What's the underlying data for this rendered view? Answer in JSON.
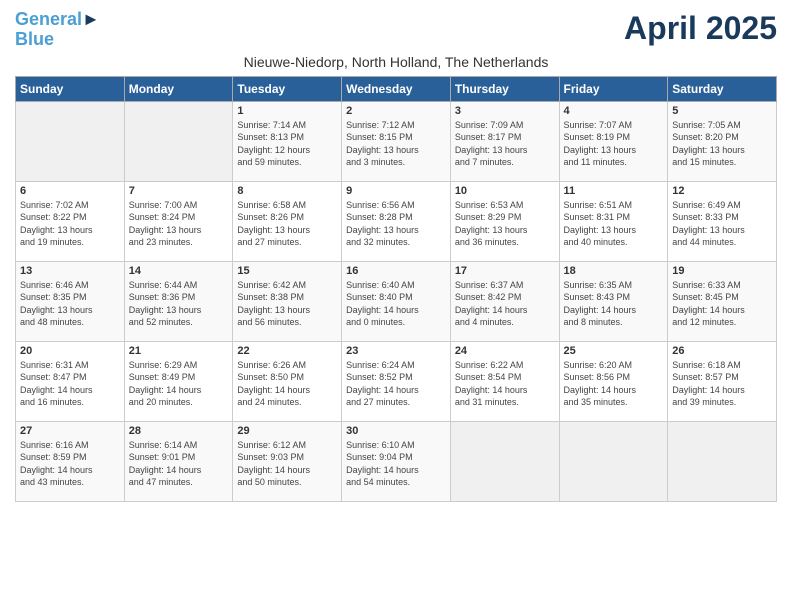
{
  "title": "April 2025",
  "subtitle": "Nieuwe-Niedorp, North Holland, The Netherlands",
  "logo": {
    "line1": "General",
    "line2": "Blue"
  },
  "days_header": [
    "Sunday",
    "Monday",
    "Tuesday",
    "Wednesday",
    "Thursday",
    "Friday",
    "Saturday"
  ],
  "weeks": [
    [
      {
        "day": "",
        "info": ""
      },
      {
        "day": "",
        "info": ""
      },
      {
        "day": "1",
        "info": "Sunrise: 7:14 AM\nSunset: 8:13 PM\nDaylight: 12 hours\nand 59 minutes."
      },
      {
        "day": "2",
        "info": "Sunrise: 7:12 AM\nSunset: 8:15 PM\nDaylight: 13 hours\nand 3 minutes."
      },
      {
        "day": "3",
        "info": "Sunrise: 7:09 AM\nSunset: 8:17 PM\nDaylight: 13 hours\nand 7 minutes."
      },
      {
        "day": "4",
        "info": "Sunrise: 7:07 AM\nSunset: 8:19 PM\nDaylight: 13 hours\nand 11 minutes."
      },
      {
        "day": "5",
        "info": "Sunrise: 7:05 AM\nSunset: 8:20 PM\nDaylight: 13 hours\nand 15 minutes."
      }
    ],
    [
      {
        "day": "6",
        "info": "Sunrise: 7:02 AM\nSunset: 8:22 PM\nDaylight: 13 hours\nand 19 minutes."
      },
      {
        "day": "7",
        "info": "Sunrise: 7:00 AM\nSunset: 8:24 PM\nDaylight: 13 hours\nand 23 minutes."
      },
      {
        "day": "8",
        "info": "Sunrise: 6:58 AM\nSunset: 8:26 PM\nDaylight: 13 hours\nand 27 minutes."
      },
      {
        "day": "9",
        "info": "Sunrise: 6:56 AM\nSunset: 8:28 PM\nDaylight: 13 hours\nand 32 minutes."
      },
      {
        "day": "10",
        "info": "Sunrise: 6:53 AM\nSunset: 8:29 PM\nDaylight: 13 hours\nand 36 minutes."
      },
      {
        "day": "11",
        "info": "Sunrise: 6:51 AM\nSunset: 8:31 PM\nDaylight: 13 hours\nand 40 minutes."
      },
      {
        "day": "12",
        "info": "Sunrise: 6:49 AM\nSunset: 8:33 PM\nDaylight: 13 hours\nand 44 minutes."
      }
    ],
    [
      {
        "day": "13",
        "info": "Sunrise: 6:46 AM\nSunset: 8:35 PM\nDaylight: 13 hours\nand 48 minutes."
      },
      {
        "day": "14",
        "info": "Sunrise: 6:44 AM\nSunset: 8:36 PM\nDaylight: 13 hours\nand 52 minutes."
      },
      {
        "day": "15",
        "info": "Sunrise: 6:42 AM\nSunset: 8:38 PM\nDaylight: 13 hours\nand 56 minutes."
      },
      {
        "day": "16",
        "info": "Sunrise: 6:40 AM\nSunset: 8:40 PM\nDaylight: 14 hours\nand 0 minutes."
      },
      {
        "day": "17",
        "info": "Sunrise: 6:37 AM\nSunset: 8:42 PM\nDaylight: 14 hours\nand 4 minutes."
      },
      {
        "day": "18",
        "info": "Sunrise: 6:35 AM\nSunset: 8:43 PM\nDaylight: 14 hours\nand 8 minutes."
      },
      {
        "day": "19",
        "info": "Sunrise: 6:33 AM\nSunset: 8:45 PM\nDaylight: 14 hours\nand 12 minutes."
      }
    ],
    [
      {
        "day": "20",
        "info": "Sunrise: 6:31 AM\nSunset: 8:47 PM\nDaylight: 14 hours\nand 16 minutes."
      },
      {
        "day": "21",
        "info": "Sunrise: 6:29 AM\nSunset: 8:49 PM\nDaylight: 14 hours\nand 20 minutes."
      },
      {
        "day": "22",
        "info": "Sunrise: 6:26 AM\nSunset: 8:50 PM\nDaylight: 14 hours\nand 24 minutes."
      },
      {
        "day": "23",
        "info": "Sunrise: 6:24 AM\nSunset: 8:52 PM\nDaylight: 14 hours\nand 27 minutes."
      },
      {
        "day": "24",
        "info": "Sunrise: 6:22 AM\nSunset: 8:54 PM\nDaylight: 14 hours\nand 31 minutes."
      },
      {
        "day": "25",
        "info": "Sunrise: 6:20 AM\nSunset: 8:56 PM\nDaylight: 14 hours\nand 35 minutes."
      },
      {
        "day": "26",
        "info": "Sunrise: 6:18 AM\nSunset: 8:57 PM\nDaylight: 14 hours\nand 39 minutes."
      }
    ],
    [
      {
        "day": "27",
        "info": "Sunrise: 6:16 AM\nSunset: 8:59 PM\nDaylight: 14 hours\nand 43 minutes."
      },
      {
        "day": "28",
        "info": "Sunrise: 6:14 AM\nSunset: 9:01 PM\nDaylight: 14 hours\nand 47 minutes."
      },
      {
        "day": "29",
        "info": "Sunrise: 6:12 AM\nSunset: 9:03 PM\nDaylight: 14 hours\nand 50 minutes."
      },
      {
        "day": "30",
        "info": "Sunrise: 6:10 AM\nSunset: 9:04 PM\nDaylight: 14 hours\nand 54 minutes."
      },
      {
        "day": "",
        "info": ""
      },
      {
        "day": "",
        "info": ""
      },
      {
        "day": "",
        "info": ""
      }
    ]
  ]
}
